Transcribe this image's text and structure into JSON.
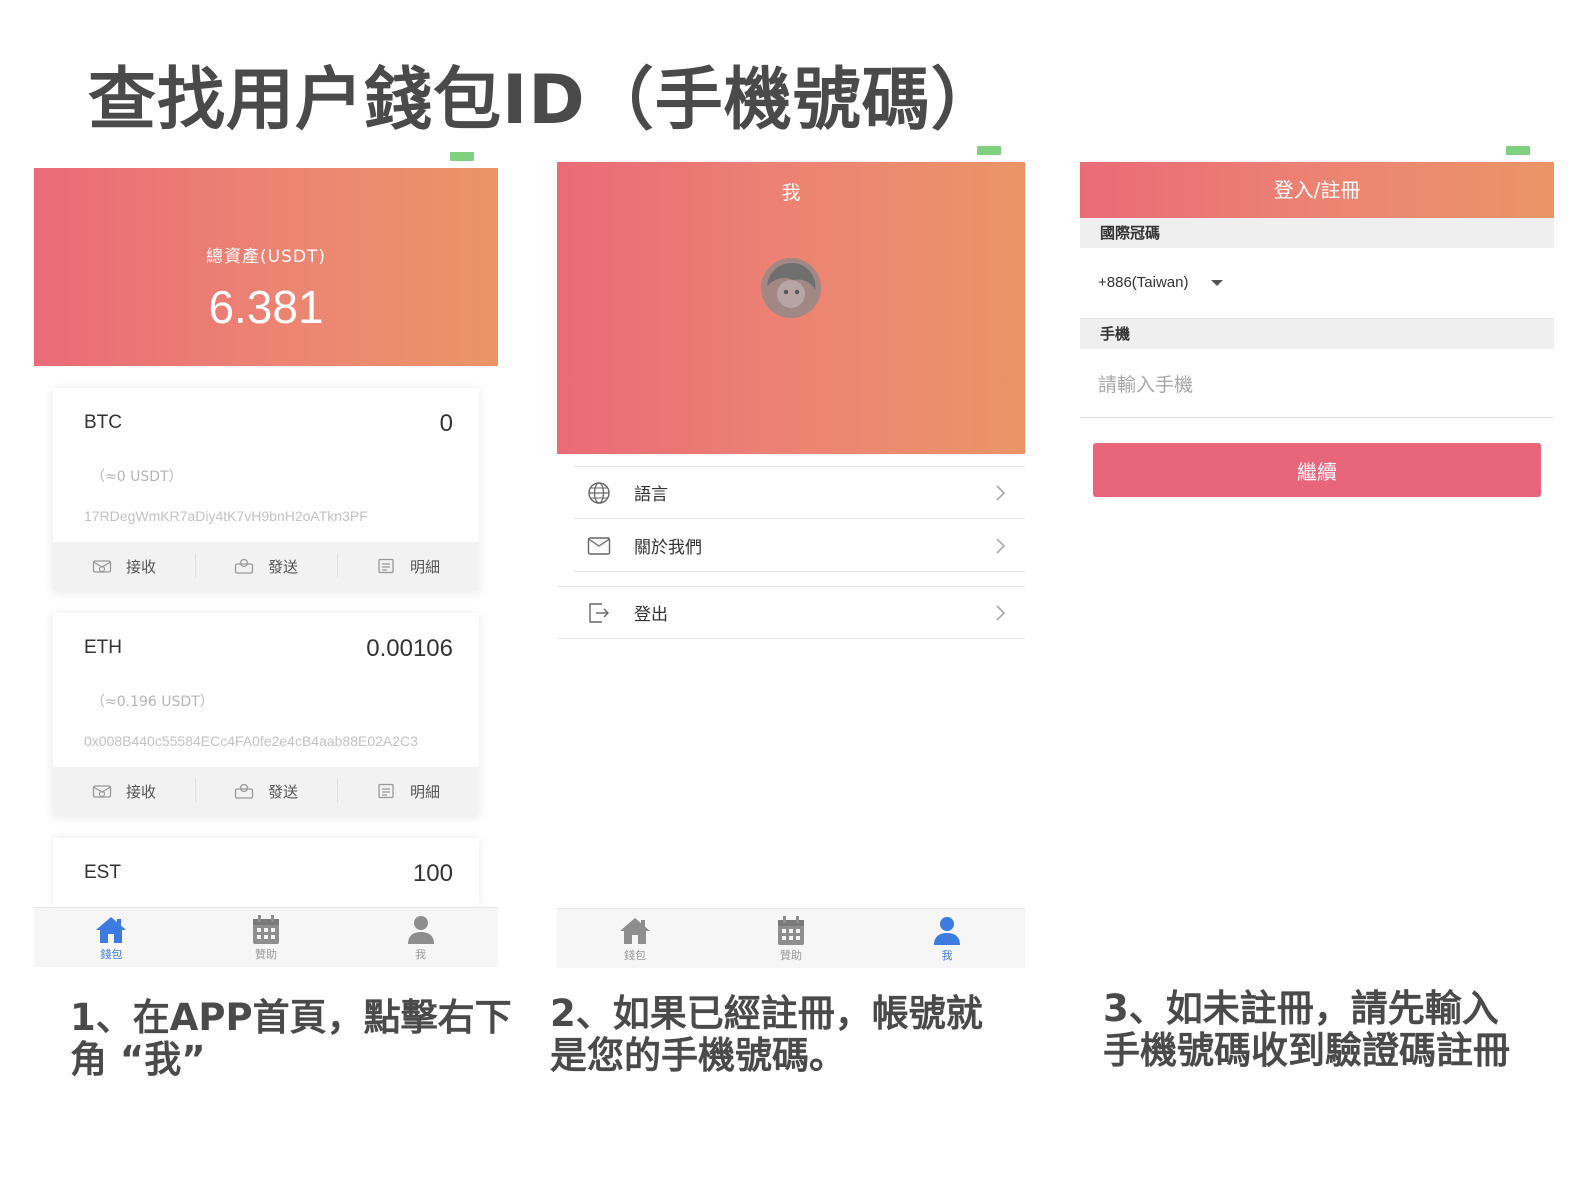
{
  "page_title": "查找用户錢包ID（手機號碼）",
  "captions": [
    [
      "1、在APP首頁，點擊右下",
      "角 “我”"
    ],
    [
      "2、如果已經註冊，帳號就",
      "是您的手機號碼。"
    ],
    [
      "3、如未註冊，請先輸入",
      "手機號碼收到驗證碼註冊"
    ]
  ],
  "colors": {
    "gradient_start": "#ea6b77",
    "gradient_end": "#ea9466",
    "button": "#e8657a",
    "tab_active": "#3e7be0",
    "battery": "#7fd17f"
  },
  "wallet": {
    "total_label": "總資產(USDT)",
    "total_value": "6.381",
    "coins": [
      {
        "name": "BTC",
        "amount": "0",
        "usdt": "（≈0 USDT）",
        "address": "17RDegWmKR7aDiy4tK7vH9bnH2oATkn3PF"
      },
      {
        "name": "ETH",
        "amount": "0.00106",
        "usdt": "（≈0.196 USDT）",
        "address": "0x008B440c55584ECc4FA0fe2e4cB4aab88E02A2C3"
      },
      {
        "name": "EST",
        "amount": "100"
      }
    ],
    "actions": {
      "receive": "接收",
      "send": "發送",
      "detail": "明細"
    }
  },
  "tabs": {
    "wallet": "錢包",
    "sponsor": "贊助",
    "me": "我"
  },
  "profile": {
    "title": "我",
    "menu": {
      "language": "語言",
      "about": "關於我們",
      "logout": "登出"
    }
  },
  "login": {
    "title": "登入/註冊",
    "country_label": "國際冠碼",
    "country_value": "+886(Taiwan)",
    "phone_label": "手機",
    "phone_placeholder": "請輸入手機",
    "continue": "繼續"
  }
}
